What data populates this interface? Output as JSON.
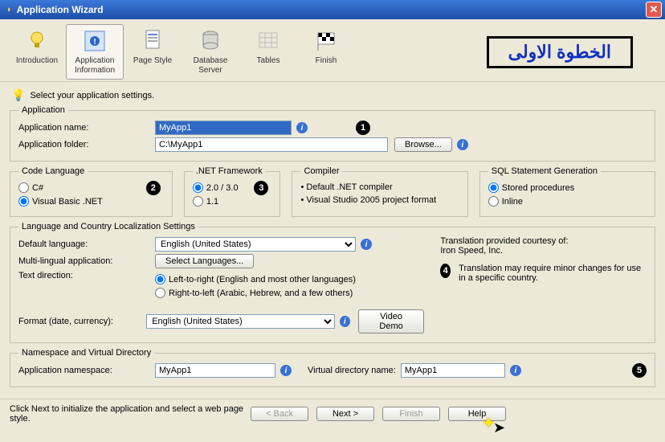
{
  "window": {
    "title": "Application Wizard"
  },
  "toolbar": {
    "items": [
      {
        "label": "Introduction"
      },
      {
        "label": "Application Information"
      },
      {
        "label": "Page Style"
      },
      {
        "label": "Database Server"
      },
      {
        "label": "Tables"
      },
      {
        "label": "Finish"
      }
    ]
  },
  "arabic_label": "الخطوة الاولى",
  "hint": "Select your application settings.",
  "application": {
    "legend": "Application",
    "name_label": "Application name:",
    "name_value": "MyApp1",
    "folder_label": "Application folder:",
    "folder_value": "C:\\MyApp1",
    "browse_btn": "Browse..."
  },
  "code_lang": {
    "legend": "Code Language",
    "csharp": "C#",
    "vbnet": "Visual Basic .NET"
  },
  "framework": {
    "legend": ".NET Framework",
    "opt1": "2.0 / 3.0",
    "opt2": "1.1"
  },
  "compiler": {
    "legend": "Compiler",
    "line1": "Default .NET compiler",
    "line2": "Visual Studio 2005 project format"
  },
  "sqlgen": {
    "legend": "SQL Statement Generation",
    "opt1": "Stored procedures",
    "opt2": "Inline"
  },
  "locale": {
    "legend": "Language and Country Localization Settings",
    "default_lang_label": "Default language:",
    "default_lang_value": "English (United States)",
    "multi_label": "Multi-lingual application:",
    "select_langs_btn": "Select Languages...",
    "textdir_label": "Text direction:",
    "ltr": "Left-to-right (English and most other languages)",
    "rtl": "Right-to-left (Arabic, Hebrew, and a few others)",
    "format_label": "Format (date, currency):",
    "format_value": "English (United States)",
    "video_btn": "Video Demo",
    "courtesy1": "Translation provided courtesy of:",
    "courtesy2": "Iron Speed, Inc.",
    "courtesy3": "Translation may require minor changes for use in a specific country."
  },
  "ns": {
    "legend": "Namespace and Virtual Directory",
    "ns_label": "Application namespace:",
    "ns_value": "MyApp1",
    "vd_label": "Virtual directory name:",
    "vd_value": "MyApp1"
  },
  "footer": {
    "msg": "Click Next to initialize the application and select a web page style.",
    "back": "< Back",
    "next": "Next >",
    "finish": "Finish",
    "help": "Help"
  },
  "badges": {
    "b1": "1",
    "b2": "2",
    "b3": "3",
    "b4": "4",
    "b5": "5"
  }
}
